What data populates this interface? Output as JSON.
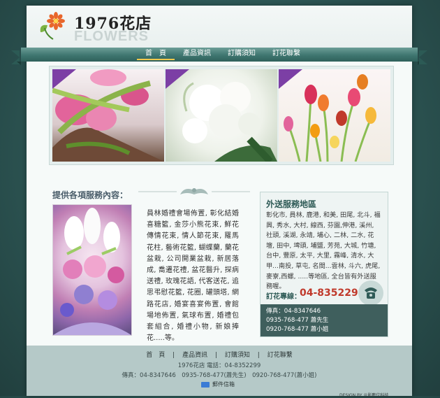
{
  "brand": {
    "title": "1976花店",
    "subtitle": "FLOWERS"
  },
  "nav": {
    "items": [
      "首　頁",
      "產品資訊",
      "訂購須知",
      "訂花聯繫"
    ],
    "active_index": 0
  },
  "services": {
    "title": "提供各項服務內容：",
    "text": "員林婚禮會場佈置, 彰化結婚喜糖籃, 金莎小熊花束, 鮮花傳情花束, 情人節花束, 羅馬花柱, 藝術花籃, 蝴蝶蘭, 蘭花盆栽, 公司開業盆栽, 新居落成, 喬遷花禮, 盆花醫升, 探病送禮, 玫瑰花語, 代客送花, 追思弔慰花籃, 花圈, 罐頭塔, 網路花店, 婚宴喜宴佈置, 會館場地佈置, 氣球布置, 婚禮包套組合, 婚禮小物, 新娘捧花.....等。"
  },
  "delivery": {
    "title": "外送服務地區",
    "text": "彰化市, 員林, 鹿港, 和美, 田尾, 北斗, 福興, 秀水, 大村, 線西, 芬園,伸港, 溪州, 社頭, 溪湖, 永靖, 埔心, 二林, 二水, 花壇, 田中, 埤頭, 埔鹽, 芳苑, 大城, 竹塘, 台中, 豐原, 太平, 大里, 霧峰, 清水, 大甲...南投, 草屯, 名間...雲林, 斗六, 虎尾, 麥寮,西螺, .....等地區, 全台皆有外送服務喔。",
    "hotline_label": "訂花專線：",
    "hotline_number": "04-8352299",
    "contacts": [
      "傳真：04-8347646",
      "0935-768-477 蕭先生",
      "0920-768-477 蕭小姐"
    ]
  },
  "footer": {
    "nav": [
      "首　頁",
      "產品資訊",
      "訂購須知",
      "訂花聯繫"
    ],
    "separator": "|",
    "line1": "1976花店 電話：04-8352299",
    "line2": "傳真：04-8347646　0935-768-477(蕭先生)　0920-768-477(蕭小姐)",
    "mail": "郵件信箱",
    "design": "DESIGN BY 元影數位科技"
  },
  "colors": {
    "nav_band": "#3f7670",
    "accent_red": "#c0392b",
    "ribbon_purple": "#7c3fa5",
    "dark_box": "#3f5f5d"
  }
}
